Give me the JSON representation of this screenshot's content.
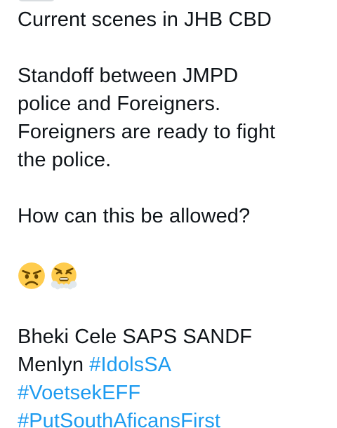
{
  "tweet": {
    "line_1": "Current scenes in JHB CBD",
    "line_2": "Standoff between JMPD",
    "line_3": "police and Foreigners.",
    "line_4": "Foreigners are ready to fight",
    "line_5": "the police.",
    "line_6": "How can this be allowed?",
    "emojis": [
      "angry-face-emoji",
      "face-with-steam-from-nose-emoji"
    ],
    "line_7": "Bheki Cele SAPS SANDF",
    "line_8_prefix": "Menlyn ",
    "hashtag_1": "#IdolsSA",
    "hashtag_2": "#VoetsekEFF",
    "hashtag_3": "#PutSouthAficansFirst"
  },
  "colors": {
    "text": "#0f1419",
    "hashtag": "#1d9bf0",
    "emoji_face": "#ffcc4d"
  }
}
